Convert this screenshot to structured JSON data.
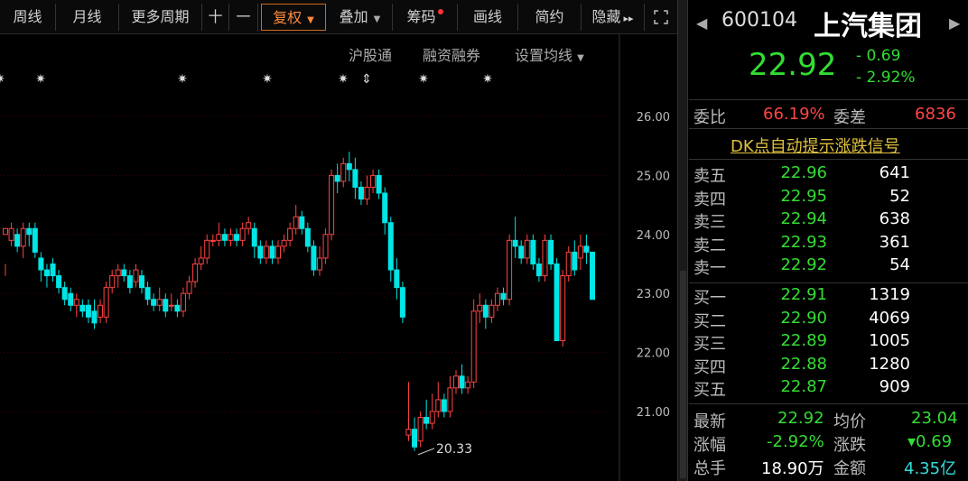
{
  "toolbar": {
    "items": [
      "周线",
      "月线",
      "更多周期",
      "十",
      "一",
      "复权",
      "叠加",
      "筹码",
      "画线",
      "简约",
      "隐藏"
    ],
    "active": "复权",
    "expand_icon": "expand-icon",
    "hide_arrow": "▸▸"
  },
  "chart": {
    "subtabs": [
      "沪股通",
      "融资融券",
      "设置均线"
    ],
    "price_axis": [
      "26.00",
      "25.00",
      "24.00",
      "23.00",
      "22.00",
      "21.00"
    ],
    "low_marker": "20.33",
    "colors": {
      "up": "#ff4444",
      "down": "#00e5e5",
      "grid": "#2a0000"
    }
  },
  "chart_data": {
    "type": "candlestick",
    "ylim": [
      20.0,
      26.6
    ],
    "candles": [
      [
        24.0,
        24.1,
        23.5,
        23.3
      ],
      [
        23.9,
        24.1,
        24.2,
        23.8
      ],
      [
        24.0,
        23.8,
        24.1,
        23.7
      ],
      [
        23.8,
        24.1,
        24.2,
        23.6
      ],
      [
        24.1,
        24.0,
        24.2,
        23.8
      ],
      [
        24.1,
        23.7,
        24.2,
        23.6
      ],
      [
        23.6,
        23.4,
        23.7,
        23.2
      ],
      [
        23.4,
        23.3,
        23.5,
        23.1
      ],
      [
        23.5,
        23.3,
        23.6,
        23.2
      ],
      [
        23.3,
        23.1,
        23.4,
        23.0
      ],
      [
        23.1,
        22.9,
        23.2,
        22.8
      ],
      [
        23.0,
        22.8,
        23.1,
        22.7
      ],
      [
        22.8,
        22.9,
        23.0,
        22.6
      ],
      [
        22.8,
        22.7,
        22.9,
        22.6
      ],
      [
        22.8,
        22.6,
        22.9,
        22.5
      ],
      [
        22.7,
        22.5,
        22.9,
        22.4
      ],
      [
        22.6,
        22.8,
        22.9,
        22.5
      ],
      [
        22.6,
        23.1,
        23.2,
        22.5
      ],
      [
        23.1,
        23.3,
        23.4,
        23.0
      ],
      [
        23.3,
        23.4,
        23.5,
        23.1
      ],
      [
        23.4,
        23.3,
        23.5,
        23.2
      ],
      [
        23.3,
        23.1,
        23.4,
        23.0
      ],
      [
        23.2,
        23.4,
        23.5,
        23.1
      ],
      [
        23.3,
        23.1,
        23.4,
        23.0
      ],
      [
        23.1,
        22.9,
        23.2,
        22.8
      ],
      [
        22.9,
        22.8,
        23.0,
        22.7
      ],
      [
        22.8,
        22.9,
        23.1,
        22.7
      ],
      [
        22.9,
        22.7,
        23.0,
        22.6
      ],
      [
        22.8,
        22.8,
        23.0,
        22.7
      ],
      [
        22.8,
        22.7,
        22.9,
        22.6
      ],
      [
        22.7,
        23.0,
        23.1,
        22.6
      ],
      [
        23.0,
        23.2,
        23.3,
        22.9
      ],
      [
        23.2,
        23.5,
        23.6,
        23.1
      ],
      [
        23.5,
        23.6,
        23.8,
        23.4
      ],
      [
        23.6,
        23.9,
        24.0,
        23.5
      ],
      [
        23.9,
        23.9,
        24.0,
        23.8
      ],
      [
        23.9,
        24.0,
        24.2,
        23.8
      ],
      [
        24.0,
        23.9,
        24.1,
        23.8
      ],
      [
        23.9,
        24.0,
        24.1,
        23.8
      ],
      [
        24.0,
        23.9,
        24.1,
        23.8
      ],
      [
        23.9,
        24.1,
        24.2,
        23.8
      ],
      [
        24.1,
        24.2,
        24.3,
        24.0
      ],
      [
        24.1,
        23.8,
        24.2,
        23.6
      ],
      [
        23.8,
        23.6,
        23.9,
        23.5
      ],
      [
        23.6,
        23.8,
        23.9,
        23.5
      ],
      [
        23.8,
        23.6,
        23.9,
        23.5
      ],
      [
        23.6,
        23.8,
        23.9,
        23.5
      ],
      [
        23.8,
        23.9,
        24.0,
        23.7
      ],
      [
        23.9,
        24.1,
        24.2,
        23.8
      ],
      [
        24.1,
        24.3,
        24.5,
        24.0
      ],
      [
        24.3,
        24.1,
        24.4,
        24.0
      ],
      [
        24.1,
        23.8,
        24.2,
        23.7
      ],
      [
        23.8,
        23.4,
        23.9,
        23.3
      ],
      [
        23.4,
        23.6,
        23.8,
        23.3
      ],
      [
        23.6,
        24.0,
        24.1,
        23.5
      ],
      [
        24.0,
        25.0,
        25.1,
        23.9
      ],
      [
        25.0,
        24.9,
        25.2,
        24.7
      ],
      [
        24.9,
        25.2,
        25.3,
        24.8
      ],
      [
        25.2,
        25.1,
        25.4,
        24.9
      ],
      [
        25.1,
        24.8,
        25.3,
        24.6
      ],
      [
        24.8,
        24.6,
        24.9,
        24.5
      ],
      [
        24.6,
        24.8,
        25.0,
        24.5
      ],
      [
        24.8,
        25.0,
        25.1,
        24.7
      ],
      [
        25.0,
        24.7,
        25.1,
        24.6
      ],
      [
        24.7,
        24.2,
        24.8,
        24.0
      ],
      [
        24.2,
        23.4,
        24.3,
        23.2
      ],
      [
        23.4,
        23.1,
        23.6,
        22.9
      ],
      [
        23.1,
        22.6,
        23.2,
        22.5
      ],
      [
        20.6,
        20.7,
        21.5,
        20.5
      ],
      [
        20.7,
        20.4,
        20.9,
        20.33
      ],
      [
        20.5,
        20.9,
        21.0,
        20.4
      ],
      [
        20.9,
        20.8,
        21.2,
        20.7
      ],
      [
        20.8,
        21.0,
        21.3,
        20.7
      ],
      [
        21.0,
        21.2,
        21.5,
        20.9
      ],
      [
        21.2,
        21.0,
        21.3,
        20.9
      ],
      [
        21.0,
        21.4,
        21.6,
        20.9
      ],
      [
        21.4,
        21.6,
        21.7,
        21.3
      ],
      [
        21.6,
        21.4,
        21.8,
        21.3
      ],
      [
        21.4,
        21.5,
        21.6,
        21.3
      ],
      [
        21.5,
        22.7,
        22.9,
        21.4
      ],
      [
        22.7,
        22.8,
        23.0,
        22.5
      ],
      [
        22.8,
        22.6,
        22.9,
        22.4
      ],
      [
        22.6,
        22.8,
        22.9,
        22.5
      ],
      [
        22.8,
        23.0,
        23.1,
        22.7
      ],
      [
        23.0,
        22.9,
        23.1,
        22.8
      ],
      [
        22.9,
        23.9,
        24.0,
        22.8
      ],
      [
        23.9,
        23.8,
        24.3,
        23.6
      ],
      [
        23.8,
        23.6,
        23.9,
        23.5
      ],
      [
        23.6,
        23.9,
        24.0,
        23.5
      ],
      [
        23.9,
        23.5,
        24.0,
        23.4
      ],
      [
        23.5,
        23.3,
        23.6,
        23.2
      ],
      [
        23.3,
        23.9,
        24.0,
        23.2
      ],
      [
        23.9,
        23.5,
        24.0,
        23.4
      ],
      [
        23.5,
        22.2,
        23.6,
        22.2
      ],
      [
        22.2,
        23.3,
        23.4,
        22.1
      ],
      [
        23.3,
        23.7,
        23.8,
        23.2
      ],
      [
        23.7,
        23.4,
        23.9,
        23.3
      ],
      [
        23.6,
        23.8,
        24.0,
        23.4
      ],
      [
        23.8,
        23.7,
        24.0,
        23.5
      ],
      [
        23.7,
        22.9,
        23.7,
        22.9
      ]
    ]
  },
  "panel": {
    "code": "600104",
    "name": "上汽集团",
    "price": "22.92",
    "change": "- 0.69",
    "change_pct": "- 2.92%",
    "weibi_label": "委比",
    "weibi": "66.19%",
    "weicha_label": "委差",
    "weicha": "6836",
    "dk_link": "DK点自动提示涨跌信号",
    "asks": [
      {
        "label": "卖五",
        "price": "22.96",
        "vol": "641"
      },
      {
        "label": "卖四",
        "price": "22.95",
        "vol": "52"
      },
      {
        "label": "卖三",
        "price": "22.94",
        "vol": "638"
      },
      {
        "label": "卖二",
        "price": "22.93",
        "vol": "361"
      },
      {
        "label": "卖一",
        "price": "22.92",
        "vol": "54"
      }
    ],
    "bids": [
      {
        "label": "买一",
        "price": "22.91",
        "vol": "1319"
      },
      {
        "label": "买二",
        "price": "22.90",
        "vol": "4069"
      },
      {
        "label": "买三",
        "price": "22.89",
        "vol": "1005"
      },
      {
        "label": "买四",
        "price": "22.88",
        "vol": "1280"
      },
      {
        "label": "买五",
        "price": "22.87",
        "vol": "909"
      }
    ],
    "stats": {
      "latest_label": "最新",
      "latest": "22.92",
      "avg_label": "均价",
      "avg": "23.04",
      "pct_label": "涨幅",
      "pct": "-2.92%",
      "chg_label": "涨跌",
      "chg": "▾0.69",
      "vol_label": "总手",
      "vol": "18.90万",
      "amt_label": "金额",
      "amt": "4.35亿"
    }
  }
}
